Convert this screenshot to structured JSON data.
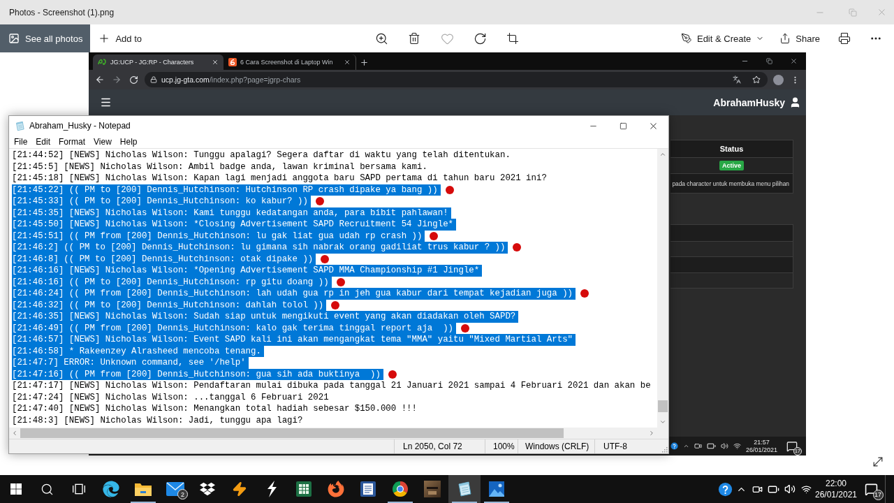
{
  "window": {
    "title": "Photos - Screenshot (1).png"
  },
  "toolbar": {
    "see_all": "See all photos",
    "add_to": "Add to",
    "favorite": false,
    "edit_create": "Edit & Create",
    "share": "Share"
  },
  "screenshot": {
    "browser": {
      "tabs": [
        {
          "title": "JG:UCP - JG:RP - Characters",
          "selected": true
        },
        {
          "title": "6 Cara Screenshot di Laptop Win",
          "selected": false
        }
      ],
      "url": {
        "host": "ucp.jg-gta.com",
        "path": "/index.php?page=jgrp-chars"
      },
      "navbar": {
        "username": "AbrahamHusky"
      },
      "status_table": {
        "header": "Status",
        "badge": "Active",
        "note": "pada character untuk membuka menu pilihan"
      }
    },
    "notepad": {
      "title": "Abraham_Husky - Notepad",
      "menu": [
        "File",
        "Edit",
        "Format",
        "View",
        "Help"
      ],
      "lines": [
        {
          "text": "[21:44:52] [NEWS] Nicholas Wilson: Tunggu apalagi? Segera daftar di waktu yang telah ditentukan.",
          "selected": false,
          "marked": false
        },
        {
          "text": "[21:45:5] [NEWS] Nicholas Wilson: Ambil badge anda, lawan kriminal bersama kami.",
          "selected": false,
          "marked": false
        },
        {
          "text": "[21:45:18] [NEWS] Nicholas Wilson: Kapan lagi menjadi anggota baru SAPD pertama di tahun baru 2021 ini?",
          "selected": false,
          "marked": false
        },
        {
          "text": "[21:45:22] (( PM to [200] Dennis_Hutchinson: Hutchinson RP crash dipake ya bang ))",
          "selected": true,
          "marked": true
        },
        {
          "text": "[21:45:33] (( PM to [200] Dennis_Hutchinson: ko kabur? ))",
          "selected": true,
          "marked": true
        },
        {
          "text": "[21:45:35] [NEWS] Nicholas Wilson: Kami tunggu kedatangan anda, para bibit pahlawan!",
          "selected": true,
          "marked": false
        },
        {
          "text": "[21:45:50] [NEWS] Nicholas Wilson: *Closing Advertisement SAPD Recruitment 54 Jingle*",
          "selected": true,
          "marked": false
        },
        {
          "text": "[21:45:51] (( PM from [200] Dennis_Hutchinson: lu gak liat gua udah rp crash ))",
          "selected": true,
          "marked": true
        },
        {
          "text": "[21:46:2] (( PM to [200] Dennis_Hutchinson: lu gimana sih nabrak orang gadiliat trus kabur ? ))",
          "selected": true,
          "marked": true
        },
        {
          "text": "[21:46:8] (( PM to [200] Dennis_Hutchinson: otak dipake ))",
          "selected": true,
          "marked": true
        },
        {
          "text": "[21:46:16] [NEWS] Nicholas Wilson: *Opening Advertisement SAPD MMA Championship #1 Jingle*",
          "selected": true,
          "marked": false
        },
        {
          "text": "[21:46:16] (( PM to [200] Dennis_Hutchinson: rp gitu doang ))",
          "selected": true,
          "marked": true
        },
        {
          "text": "[21:46:24] (( PM from [200] Dennis_Hutchinson: lah udah gua rp in jeh gua kabur dari tempat kejadian juga ))",
          "selected": true,
          "marked": true
        },
        {
          "text": "[21:46:32] (( PM to [200] Dennis_Hutchinson: dahlah tolol ))",
          "selected": true,
          "marked": true
        },
        {
          "text": "[21:46:35] [NEWS] Nicholas Wilson: Sudah siap untuk mengikuti event yang akan diadakan oleh SAPD?",
          "selected": true,
          "marked": false
        },
        {
          "text": "[21:46:49] (( PM from [200] Dennis_Hutchinson: kalo gak terima tinggal report aja  ))",
          "selected": true,
          "marked": true
        },
        {
          "text": "[21:46:57] [NEWS] Nicholas Wilson: Event SAPD kali ini akan mengangkat tema \"MMA\" yaitu \"Mixed Martial Arts\"",
          "selected": true,
          "marked": false
        },
        {
          "text": "[21:46:58] * Rakeenzey Alrasheed mencoba tenang.",
          "selected": true,
          "marked": false
        },
        {
          "text": "[21:47:7] ERROR: Unknown command, see '/help'",
          "selected": true,
          "marked": false
        },
        {
          "text": "[21:47:16] (( PM from [200] Dennis_Hutchinson: gua sih ada buktinya  ))",
          "selected": true,
          "marked": true
        },
        {
          "text": "[21:47:17] [NEWS] Nicholas Wilson: Pendaftaran mulai dibuka pada tanggal 21 Januari 2021 sampai 4 Februari 2021 dan akan be",
          "selected": false,
          "marked": false
        },
        {
          "text": "[21:47:24] [NEWS] Nicholas Wilson: ...tanggal 6 Februari 2021",
          "selected": false,
          "marked": false
        },
        {
          "text": "[21:47:40] [NEWS] Nicholas Wilson: Menangkan total hadiah sebesar $150.000 !!!",
          "selected": false,
          "marked": false
        },
        {
          "text": "[21:48:3] [NEWS] Nicholas Wilson: Jadi, tunggu apa lagi?",
          "selected": false,
          "marked": false
        }
      ],
      "status": [
        "Ln 2050, Col 72",
        "100%",
        "Windows (CRLF)",
        "UTF-8"
      ]
    },
    "taskbar": {
      "time": "21:57",
      "date": "26/01/2021",
      "notifications": "17"
    }
  },
  "taskbar": {
    "apps": [
      {
        "running": false,
        "selected": false
      },
      {
        "running": true,
        "selected": false
      },
      {
        "running": false,
        "selected": false,
        "badge": "2"
      },
      {
        "running": false,
        "selected": false
      },
      {
        "running": false,
        "selected": false
      },
      {
        "running": false,
        "selected": false
      },
      {
        "running": false,
        "selected": false
      },
      {
        "running": false,
        "selected": false
      },
      {
        "running": false,
        "selected": false
      },
      {
        "running": true,
        "selected": false
      },
      {
        "running": false,
        "selected": false
      },
      {
        "running": true,
        "selected": true
      },
      {
        "running": true,
        "selected": false
      }
    ],
    "time": "22:00",
    "date": "26/01/2021",
    "notifications": "17"
  }
}
